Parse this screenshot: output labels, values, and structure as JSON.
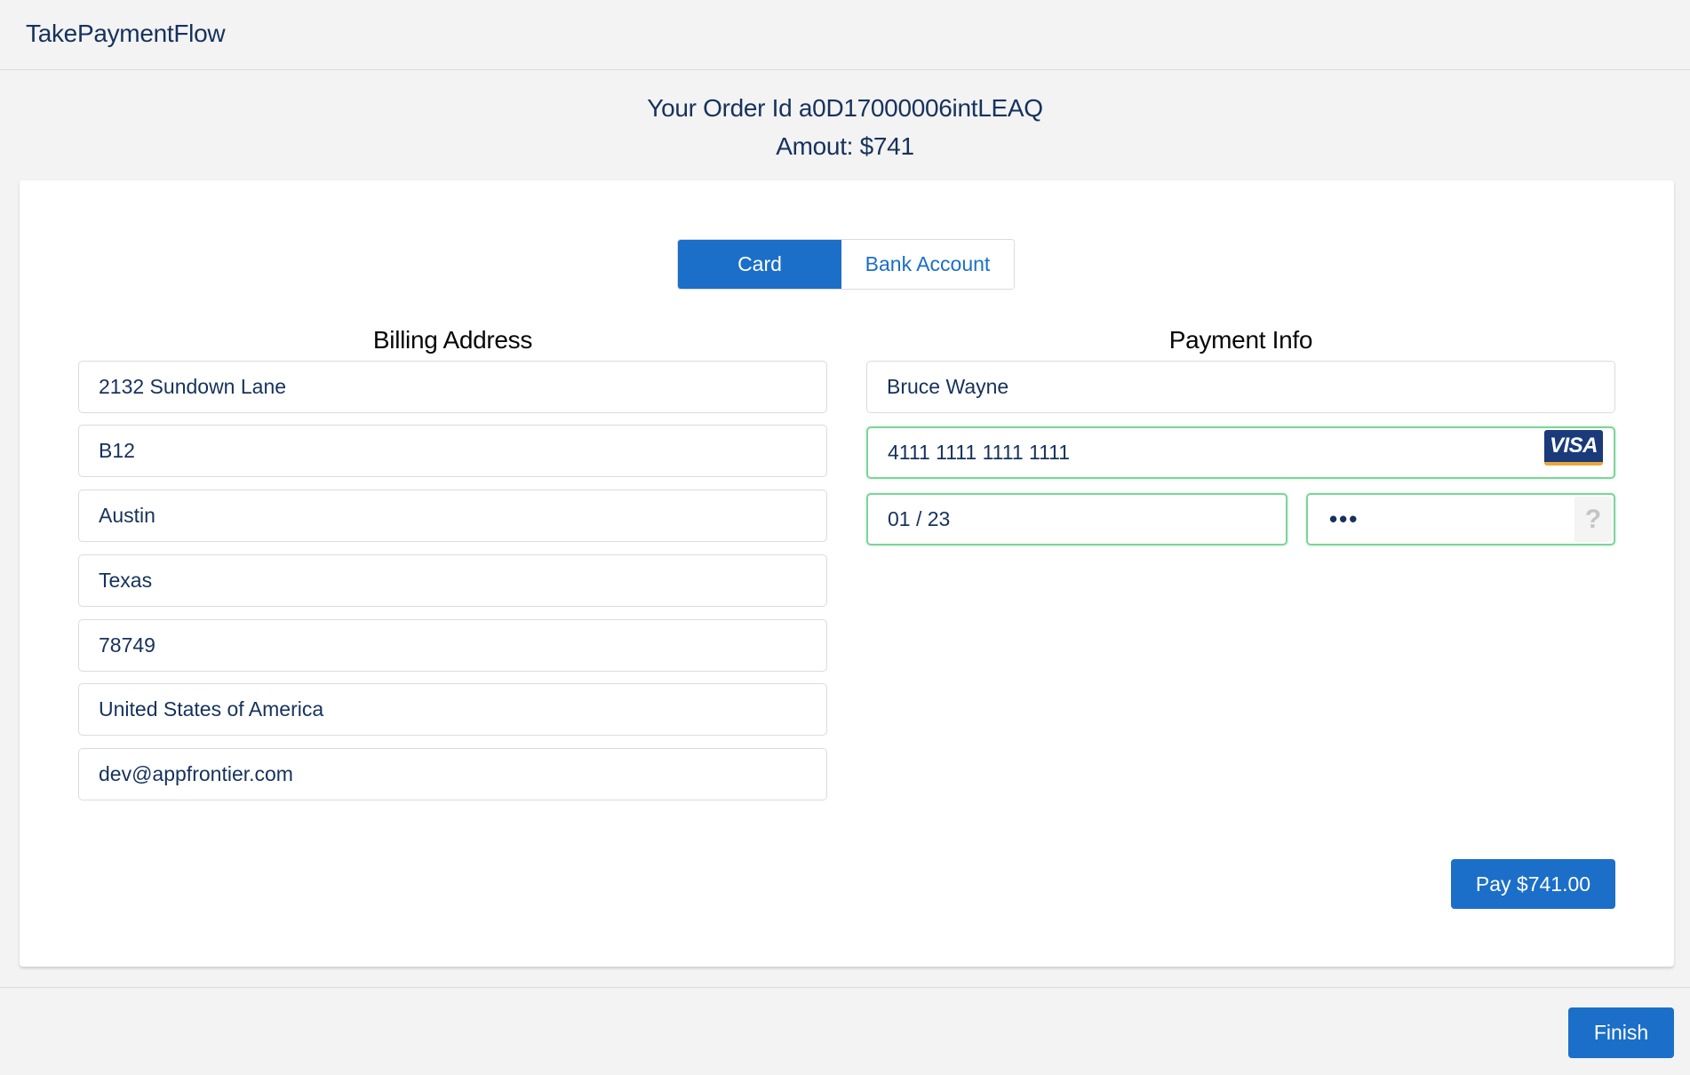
{
  "header": {
    "app_title": "TakePaymentFlow"
  },
  "order": {
    "id_line": "Your Order Id a0D17000006intLEAQ",
    "amount_line": "Amout: $741"
  },
  "tabs": [
    {
      "label": "Card",
      "selected": true
    },
    {
      "label": "Bank Account",
      "selected": false
    }
  ],
  "billing": {
    "heading": "Billing Address",
    "fields": {
      "street": "2132 Sundown Lane",
      "unit": "B12",
      "city": "Austin",
      "state": "Texas",
      "zip": "78749",
      "country": "United States of America",
      "email": "dev@appfrontier.com"
    }
  },
  "payment": {
    "heading": "Payment Info",
    "name": "Bruce Wayne",
    "card_number": "4111 1111 1111 1111",
    "card_brand": "VISA",
    "expiry": "01 / 23",
    "cvc_masked": "•••",
    "cvc_help": "?"
  },
  "actions": {
    "pay_label": "Pay $741.00",
    "finish_label": "Finish"
  },
  "colors": {
    "brand": "#1b6fc8",
    "valid_border": "#7fd39a",
    "text": "#16325c"
  }
}
